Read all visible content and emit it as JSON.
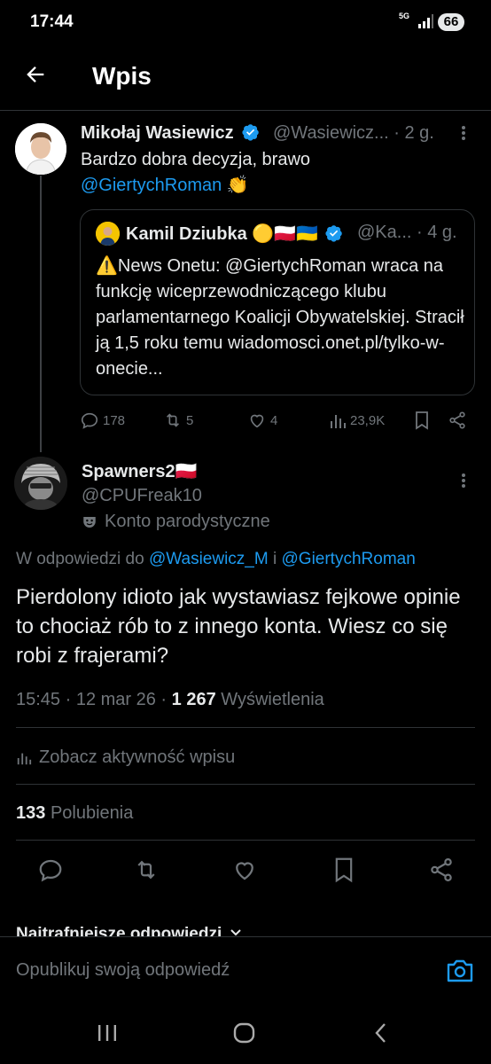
{
  "status_bar": {
    "time": "17:44",
    "network": "5G",
    "battery": "66"
  },
  "header": {
    "title": "Wpis"
  },
  "parent_tweet": {
    "name": "Mikołaj Wasiewicz",
    "handle_time": "@Wasiewicz... · 2 g.",
    "text_line1": "Bardzo dobra decyzja, brawo",
    "mention": "@GiertychRoman",
    "emoji": "👏",
    "quote": {
      "name": "Kamil Dziubka",
      "flags": "🟡🇵🇱🇺🇦",
      "handle_time": "@Ka... · 4 g.",
      "text": "⚠️News Onetu: @GiertychRoman wraca na funkcję wiceprzewodniczącego klubu parlamentarnego Koalicji Obywatelskiej. Stracił ją 1,5 roku temu wiadomosci.onet.pl/tylko-w-onecie..."
    },
    "actions": {
      "replies": "178",
      "reposts": "5",
      "likes": "4",
      "views": "23,9K"
    }
  },
  "reply": {
    "name": "Spawners2🇵🇱",
    "handle": "@CPUFreak10",
    "parody_label": "Konto parodystyczne",
    "reply_prefix": "W odpowiedzi do",
    "reply_to_1": "@Wasiewicz_M",
    "reply_and": "i",
    "reply_to_2": "@GiertychRoman",
    "text": "Pierdolony idioto jak wystawiasz fejkowe opinie to chociaż rób to z innego konta. Wiesz co się robi z frajerami?",
    "time_date": "15:45 · 12 mar 26 ·",
    "views_count": "1 267",
    "views_label": "Wyświetlenia",
    "activity_label": "Zobacz aktywność wpisu",
    "likes_count": "133",
    "likes_label": "Polubienia"
  },
  "relevant_replies": "Najtrafniejsze odpowiedzi",
  "composer": {
    "placeholder": "Opublikuj swoją odpowiedź"
  },
  "colors": {
    "accent": "#1d9bf0",
    "background": "#000000",
    "secondary_text": "#71767b"
  }
}
